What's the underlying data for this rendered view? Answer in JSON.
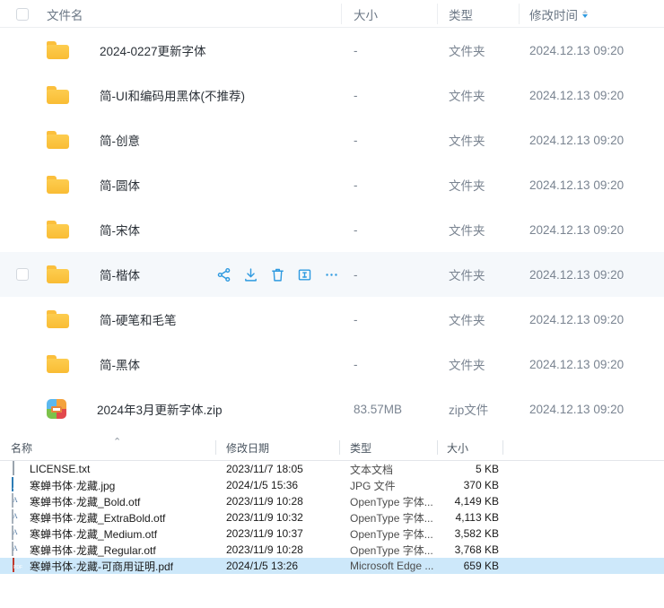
{
  "cloud_list": {
    "columns": {
      "name": "文件名",
      "size": "大小",
      "type": "类型",
      "modified": "修改时间"
    },
    "sort": {
      "column": "修改时间",
      "direction": "desc",
      "active_color": "#2f9ae0",
      "inactive_color": "#c6cdd6"
    },
    "select_all_checked": false,
    "rows": [
      {
        "name": "2024-0227更新字体",
        "icon": "folder-icon",
        "size": "-",
        "type": "文件夹",
        "modified": "2024.12.13 09:20",
        "hovered": false,
        "checked": false
      },
      {
        "name": "简-UI和编码用黑体(不推荐)",
        "icon": "folder-icon",
        "size": "-",
        "type": "文件夹",
        "modified": "2024.12.13 09:20",
        "hovered": false,
        "checked": false
      },
      {
        "name": "简-创意",
        "icon": "folder-icon",
        "size": "-",
        "type": "文件夹",
        "modified": "2024.12.13 09:20",
        "hovered": false,
        "checked": false
      },
      {
        "name": "简-圆体",
        "icon": "folder-icon",
        "size": "-",
        "type": "文件夹",
        "modified": "2024.12.13 09:20",
        "hovered": false,
        "checked": false
      },
      {
        "name": "简-宋体",
        "icon": "folder-icon",
        "size": "-",
        "type": "文件夹",
        "modified": "2024.12.13 09:20",
        "hovered": false,
        "checked": false
      },
      {
        "name": "简-楷体",
        "icon": "folder-icon",
        "size": "-",
        "type": "文件夹",
        "modified": "2024.12.13 09:20",
        "hovered": true,
        "checked": false
      },
      {
        "name": "简-硬笔和毛笔",
        "icon": "folder-icon",
        "size": "-",
        "type": "文件夹",
        "modified": "2024.12.13 09:20",
        "hovered": false,
        "checked": false
      },
      {
        "name": "简-黑体",
        "icon": "folder-icon",
        "size": "-",
        "type": "文件夹",
        "modified": "2024.12.13 09:20",
        "hovered": false,
        "checked": false
      },
      {
        "name": "2024年3月更新字体.zip",
        "icon": "zip-archive-icon",
        "size": "83.57MB",
        "type": "zip文件",
        "modified": "2024.12.13 09:20",
        "hovered": false,
        "checked": false
      }
    ],
    "row_actions": [
      {
        "name": "share-icon",
        "label": "分享"
      },
      {
        "name": "download-icon",
        "label": "下载"
      },
      {
        "name": "delete-icon",
        "label": "删除"
      },
      {
        "name": "rename-icon",
        "label": "重命名"
      },
      {
        "name": "more-icon",
        "label": "更多"
      }
    ]
  },
  "explorer_list": {
    "columns": {
      "name": "名称",
      "modified": "修改日期",
      "type": "类型",
      "size": "大小"
    },
    "sort": {
      "column": "名称",
      "direction": "asc",
      "caret": "⌃"
    },
    "rows": [
      {
        "name": "LICENSE.txt",
        "icon": "text-file-icon",
        "modified": "2023/11/7 18:05",
        "type": "文本文档",
        "size": "5 KB",
        "selected": false
      },
      {
        "name": "寒蝉书体·龙藏.jpg",
        "icon": "jpg-image-icon",
        "modified": "2024/1/5 15:36",
        "type": "JPG 文件",
        "size": "370 KB",
        "selected": false
      },
      {
        "name": "寒蝉书体·龙藏_Bold.otf",
        "icon": "opentype-font-icon",
        "modified": "2023/11/9 10:28",
        "type": "OpenType 字体...",
        "size": "4,149 KB",
        "selected": false
      },
      {
        "name": "寒蝉书体·龙藏_ExtraBold.otf",
        "icon": "opentype-font-icon",
        "modified": "2023/11/9 10:32",
        "type": "OpenType 字体...",
        "size": "4,113 KB",
        "selected": false
      },
      {
        "name": "寒蝉书体·龙藏_Medium.otf",
        "icon": "opentype-font-icon",
        "modified": "2023/11/9 10:37",
        "type": "OpenType 字体...",
        "size": "3,582 KB",
        "selected": false
      },
      {
        "name": "寒蝉书体·龙藏_Regular.otf",
        "icon": "opentype-font-icon",
        "modified": "2023/11/9 10:28",
        "type": "OpenType 字体...",
        "size": "3,768 KB",
        "selected": false
      },
      {
        "name": "寒蝉书体·龙藏-可商用证明.pdf",
        "icon": "pdf-file-icon",
        "modified": "2024/1/5 13:26",
        "type": "Microsoft Edge ...",
        "size": "659 KB",
        "selected": true
      }
    ]
  }
}
